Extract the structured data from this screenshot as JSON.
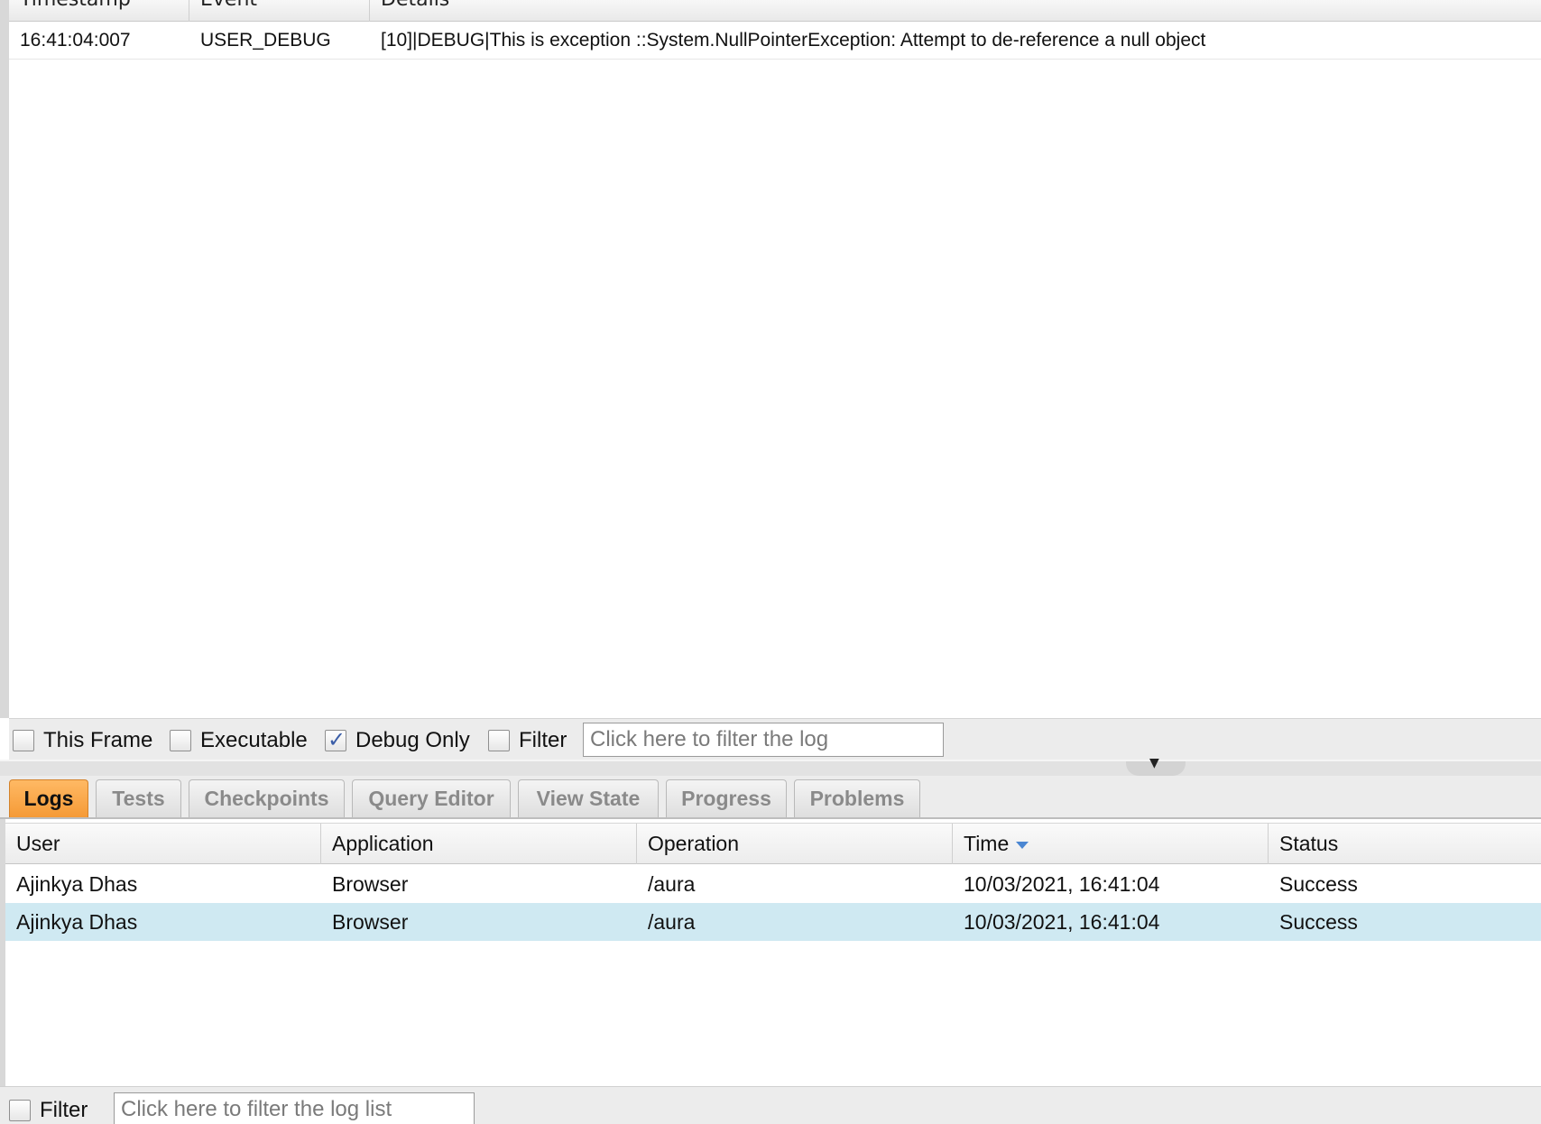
{
  "execution_log": {
    "columns": [
      "Timestamp",
      "Event",
      "Details"
    ],
    "rows": [
      {
        "timestamp": "16:41:04:007",
        "event": "USER_DEBUG",
        "details": "[10]|DEBUG|This is exception ::System.NullPointerException: Attempt to de-reference a null object"
      }
    ],
    "filters": {
      "this_frame_label": "This Frame",
      "this_frame_checked": false,
      "executable_label": "Executable",
      "executable_checked": false,
      "debug_only_label": "Debug Only",
      "debug_only_checked": true,
      "filter_label": "Filter",
      "filter_checked": false,
      "filter_placeholder": "Click here to filter the log"
    }
  },
  "tabs": [
    {
      "label": "Logs",
      "active": true
    },
    {
      "label": "Tests",
      "active": false
    },
    {
      "label": "Checkpoints",
      "active": false
    },
    {
      "label": "Query Editor",
      "active": false
    },
    {
      "label": "View State",
      "active": false
    },
    {
      "label": "Progress",
      "active": false
    },
    {
      "label": "Problems",
      "active": false
    }
  ],
  "logs_list": {
    "columns": [
      "User",
      "Application",
      "Operation",
      "Time",
      "Status"
    ],
    "sort_column": "Time",
    "sort_direction": "descending",
    "rows": [
      {
        "user": "Ajinkya Dhas",
        "application": "Browser",
        "operation": "/aura",
        "time": "10/03/2021, 16:41:04",
        "status": "Success",
        "selected": false
      },
      {
        "user": "Ajinkya Dhas",
        "application": "Browser",
        "operation": "/aura",
        "time": "10/03/2021, 16:41:04",
        "status": "Success",
        "selected": true
      }
    ],
    "filter": {
      "label": "Filter",
      "checked": false,
      "placeholder": "Click here to filter the log list"
    }
  },
  "colors": {
    "active_tab": "#f59a36",
    "selected_row": "#cfe9f2",
    "sort_arrow": "#4a86d2",
    "checkmark": "#3b5ea8"
  }
}
